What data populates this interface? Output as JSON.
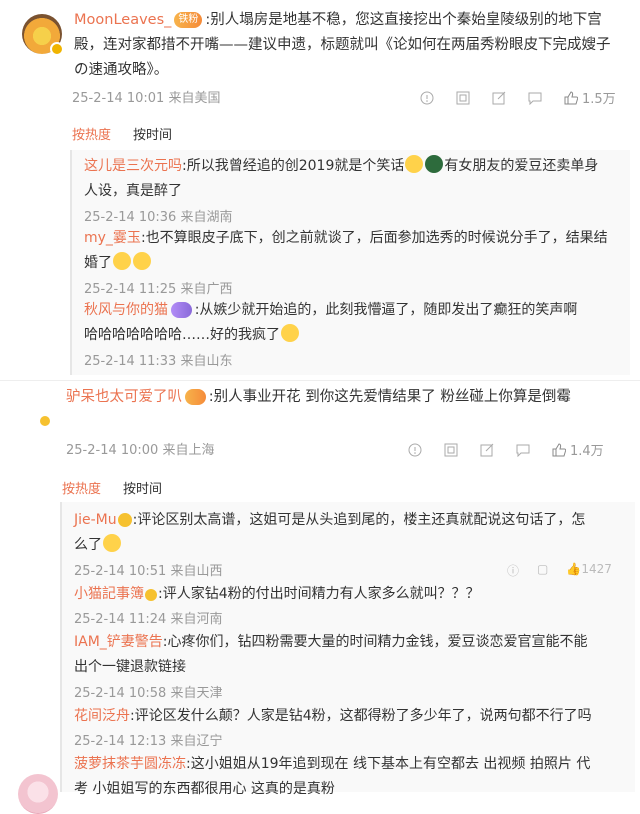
{
  "comment1": {
    "username": "MoonLeaves_",
    "fan_badge": "铁粉",
    "text_line1": ":别人塌房是地基不稳，您这直接挖出个秦始皇陵级别的地下宫",
    "text_line2": "殿，连对家都措不开嘴——建议申遗，标题就叫《论如何在两届秀粉眼皮下完成嫂子",
    "text_line3": "の速通攻略》。",
    "time": "25-2-14 10:01",
    "location": "来自美国",
    "likes": "1.5万",
    "icons": [
      "more-icon",
      "share-icon",
      "edit-icon",
      "comment-icon",
      "like-icon"
    ]
  },
  "sort1": {
    "hot": "按热度",
    "time": "按时间"
  },
  "replies1": [
    {
      "user": "这儿是三次元吗",
      "text_a": ":所以我曾经追的创2019就是个笑话",
      "text_b": "有女朋友的爱豆还卖单身",
      "text_c": "人设，真是醉了",
      "time": "25-2-14 10:36",
      "location": "来自湖南"
    },
    {
      "user": "my_霎玉",
      "text_a": ":也不算眼皮子底下，创之前就谈了，后面参加选秀的时候说分手了，结果结",
      "text_b": "婚了",
      "time": "25-2-14 11:25",
      "location": "来自广西"
    },
    {
      "user": "秋风与你的猫",
      "text_a": ":从嫉少就开始追的，此刻我懵逼了，随即发出了癫狂的笑声啊",
      "text_b": "哈哈哈哈哈哈哈……好的我疯了",
      "time": "25-2-14 11:33",
      "location": "来自山东"
    }
  ],
  "comment2": {
    "username": "驴呆也太可爱了叭",
    "text": ":别人事业开花 到你这先爱情结果了 粉丝碰上你算是倒霉",
    "time": "25-2-14 10:00",
    "location": "来自上海",
    "likes": "1.4万",
    "icons": [
      "more-icon",
      "share-icon",
      "edit-icon",
      "comment-icon",
      "like-icon"
    ]
  },
  "sort2": {
    "hot": "按热度",
    "time": "按时间"
  },
  "replies2": [
    {
      "user": "Jie-Mu",
      "text_a": ":评论区别太高谱，这姐可是从头追到尾的，楼主还真就配说这句话了，怎",
      "text_b": "么了",
      "time": "25-2-14 10:51",
      "location": "来自山西",
      "likes": "1427"
    },
    {
      "user": "小猫記事簿",
      "text_a": ":评人家钻4粉的付出时间精力有人家多么就叫？？？",
      "time": "25-2-14 11:24",
      "location": "来自河南"
    },
    {
      "user": "IAM_铲妻警告",
      "text_a": ":心疼你们，钻四粉需要大量的时间精力金钱，爱豆谈恋爱官宣能不能",
      "text_b": "出个一键退款链接",
      "time": "25-2-14 10:58",
      "location": "来自天津"
    },
    {
      "user": "花间泛舟",
      "text_a": ":评论区发什么颠？人家是钻4粉，这都得粉了多少年了，说两句都不行了吗",
      "time": "25-2-14 12:13",
      "location": "来自辽宁"
    },
    {
      "user": "菠萝抹茶芋圆冻冻",
      "text_a": ":这小姐姐从19年追到现在 线下基本上有空都去 出视频 拍照片 代",
      "text_b": "考 小姐姐写的东西都很用心 这真的是真粉"
    }
  ]
}
